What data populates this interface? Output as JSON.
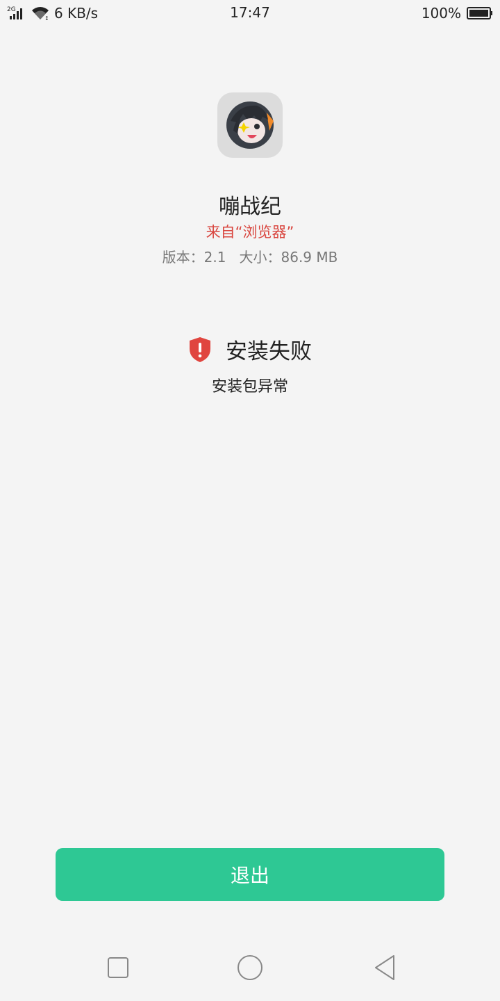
{
  "status_bar": {
    "network_type": "2G",
    "speed": "6 KB/s",
    "time": "17:47",
    "battery": "100%",
    "icons": [
      "signal-icon",
      "wifi-icon",
      "battery-icon"
    ]
  },
  "app": {
    "name": "嘣战纪",
    "source": "来自“浏览器”",
    "version_label": "版本：2.1",
    "size_label": "大小：86.9 MB",
    "icon": "app-icon"
  },
  "result": {
    "title": "安装失败",
    "detail": "安装包异常",
    "icon": "error-shield-icon",
    "icon_color": "#e0453f"
  },
  "actions": {
    "exit_label": "退出",
    "button_color": "#2ec894"
  },
  "nav": {
    "icons": [
      "recents-icon",
      "home-icon",
      "back-icon"
    ]
  }
}
